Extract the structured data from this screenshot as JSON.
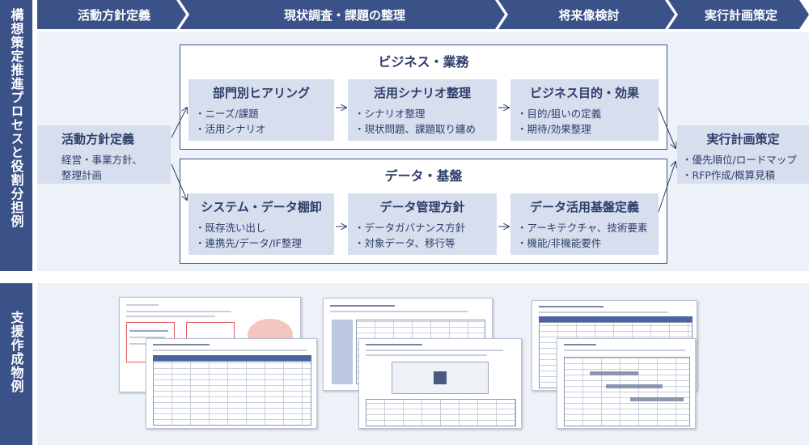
{
  "side_labels": {
    "top": "構想策定推進プロセスと役割分担例",
    "bottom": "支援作成物例"
  },
  "phases": [
    "活動方針定義",
    "現状調査・課題の整理",
    "将来像検討",
    "実行計画策定"
  ],
  "policy_box": {
    "title": "活動方針定義",
    "lines": [
      "経営・事業方針、",
      "整理計画"
    ]
  },
  "business_group": {
    "title": "ビジネス・業務",
    "boxes": [
      {
        "title": "部門別ヒアリング",
        "items": [
          "ニーズ/課題",
          "活用シナリオ"
        ]
      },
      {
        "title": "活用シナリオ整理",
        "items": [
          "シナリオ整理",
          "現状問題、課題取り纏め"
        ]
      },
      {
        "title": "ビジネス目的・効果",
        "items": [
          "目的/狙いの定義",
          "期待/効果整理"
        ]
      }
    ]
  },
  "data_group": {
    "title": "データ・基盤",
    "boxes": [
      {
        "title": "システム・データ棚卸",
        "items": [
          "既存洗い出し",
          "連携先/データ/IF整理"
        ]
      },
      {
        "title": "データ管理方針",
        "items": [
          "データガバナンス方針",
          "対象データ、移行等"
        ]
      },
      {
        "title": "データ活用基盤定義",
        "items": [
          "アーキテクチャ、技術要素",
          "機能/非機能要件"
        ]
      }
    ]
  },
  "plan_box": {
    "title": "実行計画策定",
    "items": [
      "優先順位/ロードマップ",
      "RFP作成/概算見積"
    ]
  },
  "colors": {
    "navy": "#3a5288",
    "box_fill": "#d7deee",
    "panel_bg": "#edf2f9"
  }
}
